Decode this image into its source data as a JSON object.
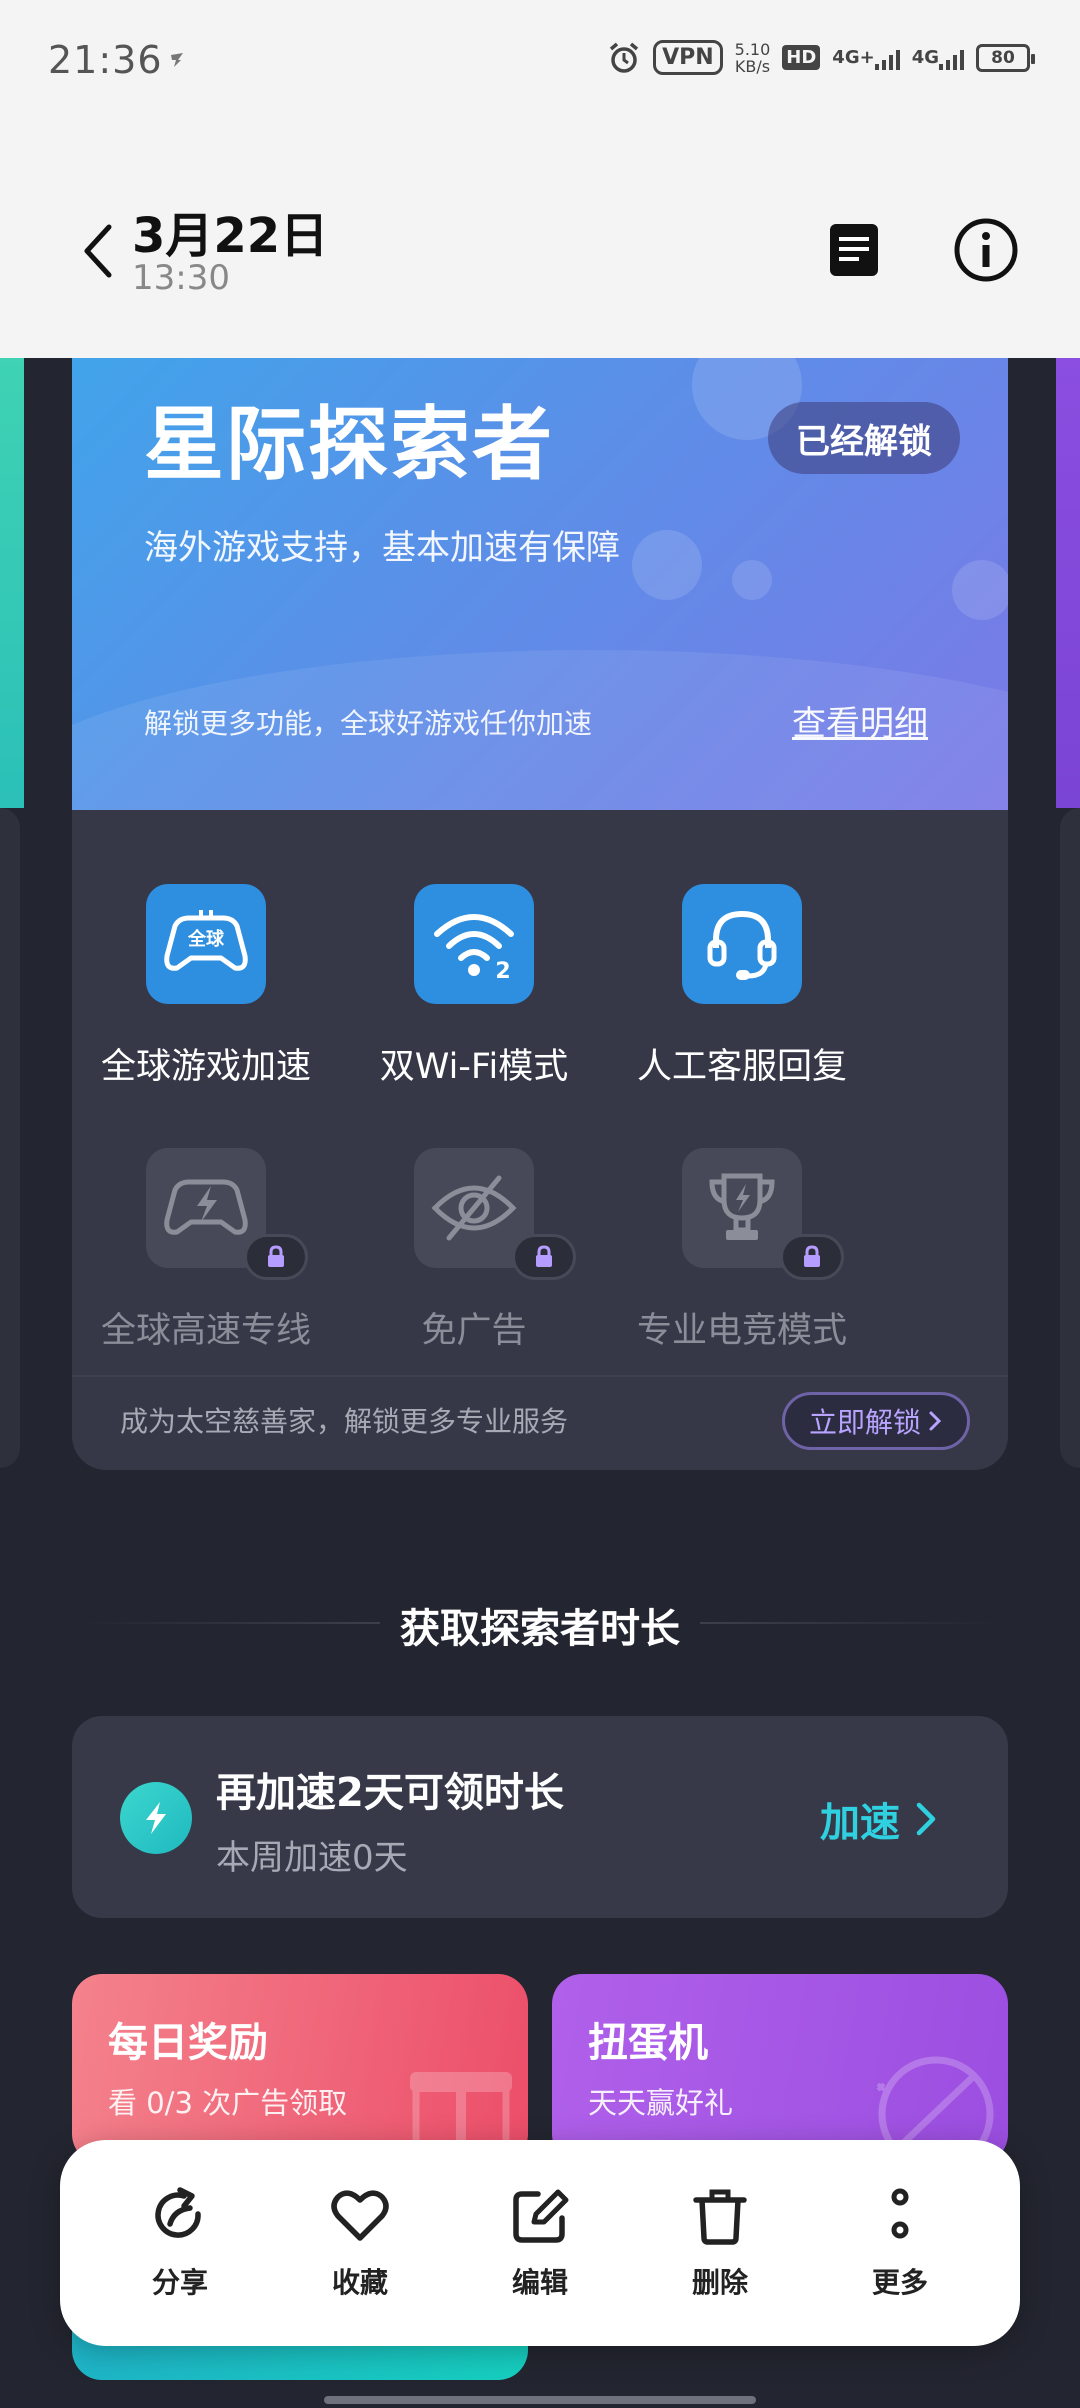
{
  "status_bar": {
    "time": "21:36",
    "vpn": "VPN",
    "speed_value": "5.10",
    "speed_unit": "KB/s",
    "hd": "HD",
    "net1": "4G+",
    "net2": "4G",
    "battery": "80"
  },
  "header": {
    "date": "3月22日",
    "time": "13:30"
  },
  "member_card": {
    "title": "星际探索者",
    "badge": "已经解锁",
    "subtitle": "海外游戏支持，基本加速有保障",
    "unlock_text": "解锁更多功能，全球好游戏任你加速",
    "detail_link": "查看明细",
    "global_icon_text": "全球",
    "wifi_icon_num": "2",
    "features": [
      {
        "label": "全球游戏加速",
        "icon": "gamepad-global-icon",
        "locked": false
      },
      {
        "label": "双Wi-Fi模式",
        "icon": "wifi-dual-icon",
        "locked": false
      },
      {
        "label": "人工客服回复",
        "icon": "headset-icon",
        "locked": false
      },
      {
        "label": "全球高速专线",
        "icon": "gamepad-lightning-icon",
        "locked": true
      },
      {
        "label": "免广告",
        "icon": "eye-off-icon",
        "locked": true
      },
      {
        "label": "专业电竞模式",
        "icon": "trophy-icon",
        "locked": true
      }
    ],
    "footer_text": "成为太空慈善家，解锁更多专业服务",
    "footer_button": "立即解锁"
  },
  "section": {
    "title": "获取探索者时长"
  },
  "task": {
    "title": "再加速2天可领时长",
    "subtitle": "本周加速0天",
    "action": "加速"
  },
  "promos": [
    {
      "title": "每日奖励",
      "subtitle": "看 0/3 次广告领取"
    },
    {
      "title": "扭蛋机",
      "subtitle": "天天赢好礼"
    }
  ],
  "action_bar": {
    "items": [
      {
        "label": "分享",
        "icon": "share-icon"
      },
      {
        "label": "收藏",
        "icon": "heart-icon"
      },
      {
        "label": "编辑",
        "icon": "edit-icon"
      },
      {
        "label": "删除",
        "icon": "trash-icon"
      },
      {
        "label": "更多",
        "icon": "more-vertical-icon"
      }
    ]
  },
  "colors": {
    "background": "#232530",
    "card": "#363847",
    "accent_blue": "#2e8ee0",
    "accent_cyan": "#2fd1e0",
    "accent_purple": "#b8a3ff"
  }
}
